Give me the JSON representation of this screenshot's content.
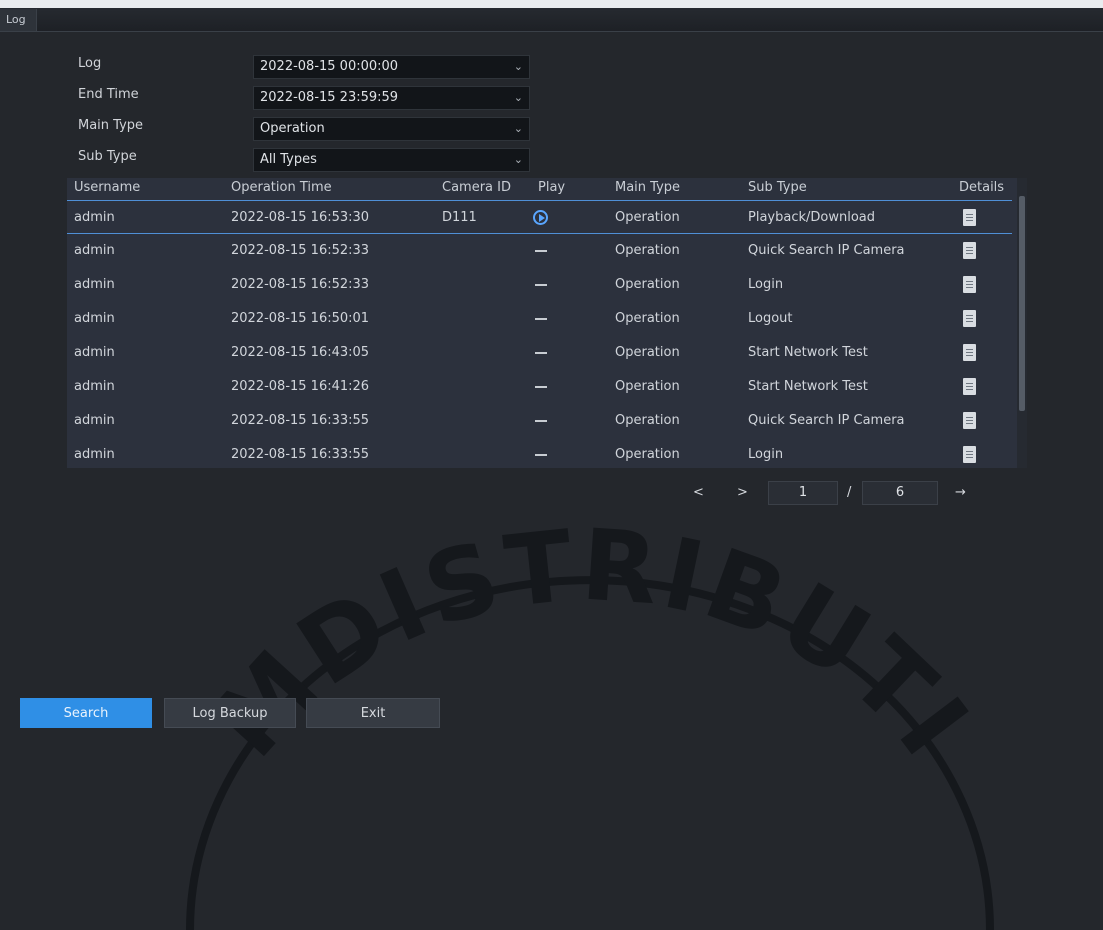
{
  "window": {
    "tab_title": "Log"
  },
  "filters": [
    {
      "label": "Log",
      "value": "2022-08-15 00:00:00"
    },
    {
      "label": "End Time",
      "value": "2022-08-15 23:59:59"
    },
    {
      "label": "Main Type",
      "value": "Operation"
    },
    {
      "label": "Sub Type",
      "value": "All Types"
    }
  ],
  "table": {
    "columns": [
      "Username",
      "Operation Time",
      "Camera ID",
      "Play",
      "Main Type",
      "Sub Type",
      "Details"
    ],
    "rows": [
      {
        "username": "admin",
        "time": "2022-08-15 16:53:30",
        "camera_id": "D111",
        "play": "play-button",
        "main_type": "Operation",
        "sub_type": "Playback/Download",
        "details": "document-icon"
      },
      {
        "username": "admin",
        "time": "2022-08-15 16:52:33",
        "camera_id": "",
        "play": "–",
        "main_type": "Operation",
        "sub_type": "Quick Search IP Camera",
        "details": "document-icon"
      },
      {
        "username": "admin",
        "time": "2022-08-15 16:52:33",
        "camera_id": "",
        "play": "–",
        "main_type": "Operation",
        "sub_type": "Login",
        "details": "document-icon"
      },
      {
        "username": "admin",
        "time": "2022-08-15 16:50:01",
        "camera_id": "",
        "play": "–",
        "main_type": "Operation",
        "sub_type": "Logout",
        "details": "document-icon"
      },
      {
        "username": "admin",
        "time": "2022-08-15 16:43:05",
        "camera_id": "",
        "play": "–",
        "main_type": "Operation",
        "sub_type": "Start Network Test",
        "details": "document-icon"
      },
      {
        "username": "admin",
        "time": "2022-08-15 16:41:26",
        "camera_id": "",
        "play": "–",
        "main_type": "Operation",
        "sub_type": "Start Network Test",
        "details": "document-icon"
      },
      {
        "username": "admin",
        "time": "2022-08-15 16:33:55",
        "camera_id": "",
        "play": "–",
        "main_type": "Operation",
        "sub_type": "Quick Search IP Camera",
        "details": "document-icon"
      },
      {
        "username": "admin",
        "time": "2022-08-15 16:33:55",
        "camera_id": "",
        "play": "–",
        "main_type": "Operation",
        "sub_type": "Login",
        "details": "document-icon"
      }
    ]
  },
  "pagination": {
    "prev": "<",
    "next": ">",
    "current_page": "1",
    "separator": "/",
    "total_pages": "6",
    "go": "→"
  },
  "buttons": {
    "search": "Search",
    "log_backup": "Log Backup",
    "exit": "Exit"
  },
  "watermark": {
    "text": "MDISTRIBUTI"
  },
  "colors": {
    "accent": "#2f8fe6",
    "selection_line": "#4f8fd6",
    "play_icon": "#5aa6ff"
  }
}
